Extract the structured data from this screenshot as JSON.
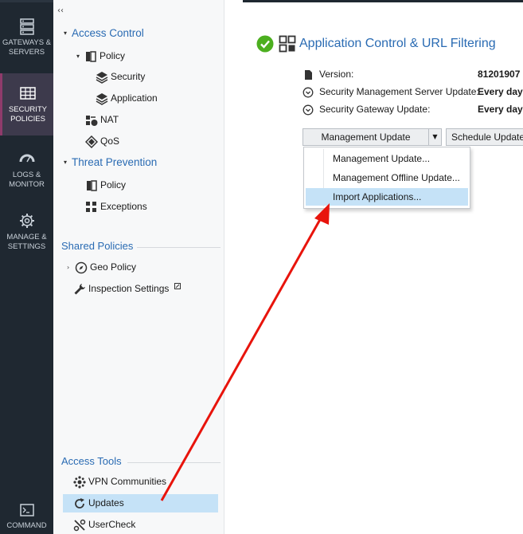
{
  "rail": {
    "items": [
      {
        "label": "GATEWAYS & SERVERS",
        "icon": "gateways-icon"
      },
      {
        "label": "SECURITY POLICIES",
        "icon": "security-policies-icon",
        "active": true
      },
      {
        "label": "LOGS & MONITOR",
        "icon": "logs-monitor-icon"
      },
      {
        "label": "MANAGE & SETTINGS",
        "icon": "manage-settings-icon"
      },
      {
        "label": "COMMAND",
        "icon": "command-line-icon"
      }
    ],
    "active_color": "#8f3b6b"
  },
  "tree": {
    "collapse_glyph": "‹‹",
    "access_control": {
      "label": "Access Control",
      "policy": "Policy",
      "security": "Security",
      "application": "Application",
      "nat": "NAT",
      "qos": "QoS"
    },
    "threat_prevention": {
      "label": "Threat Prevention",
      "policy": "Policy",
      "exceptions": "Exceptions"
    },
    "shared_policies": {
      "label": "Shared Policies",
      "geo_policy": "Geo Policy",
      "inspection_settings": "Inspection Settings"
    },
    "access_tools": {
      "label": "Access Tools",
      "vpn_communities": "VPN Communities",
      "updates": "Updates",
      "usercheck": "UserCheck"
    }
  },
  "main": {
    "title": "Application Control & URL Filtering",
    "status_color": "#4caf1f",
    "info": {
      "version_label": "Version:",
      "version_value": "81201907",
      "mgmt_label": "Security Management Server Update:",
      "mgmt_value": "Every day",
      "gw_label": "Security Gateway Update:",
      "gw_value": "Every day"
    },
    "buttons": {
      "management_update": "Management Update",
      "schedule_update": "Schedule Update"
    },
    "menu": {
      "items": [
        "Management Update...",
        "Management Offline Update...",
        "Import Applications..."
      ],
      "highlighted_index": 2
    }
  },
  "annotation": {
    "arrow_color": "#e8140c"
  }
}
